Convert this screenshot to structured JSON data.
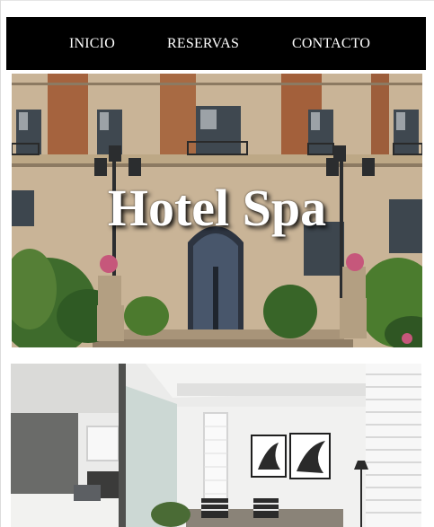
{
  "nav": {
    "items": [
      {
        "label": "INICIO"
      },
      {
        "label": "RESERVAS"
      },
      {
        "label": "CONTACTO"
      }
    ]
  },
  "hero": {
    "title": "Hotel Spa"
  },
  "images": {
    "hero": "hotel-facade-photo",
    "room": "hotel-room-photo"
  },
  "colors": {
    "nav_background": "#000000",
    "nav_text": "#ffffff",
    "page_background": "#ffffff"
  }
}
